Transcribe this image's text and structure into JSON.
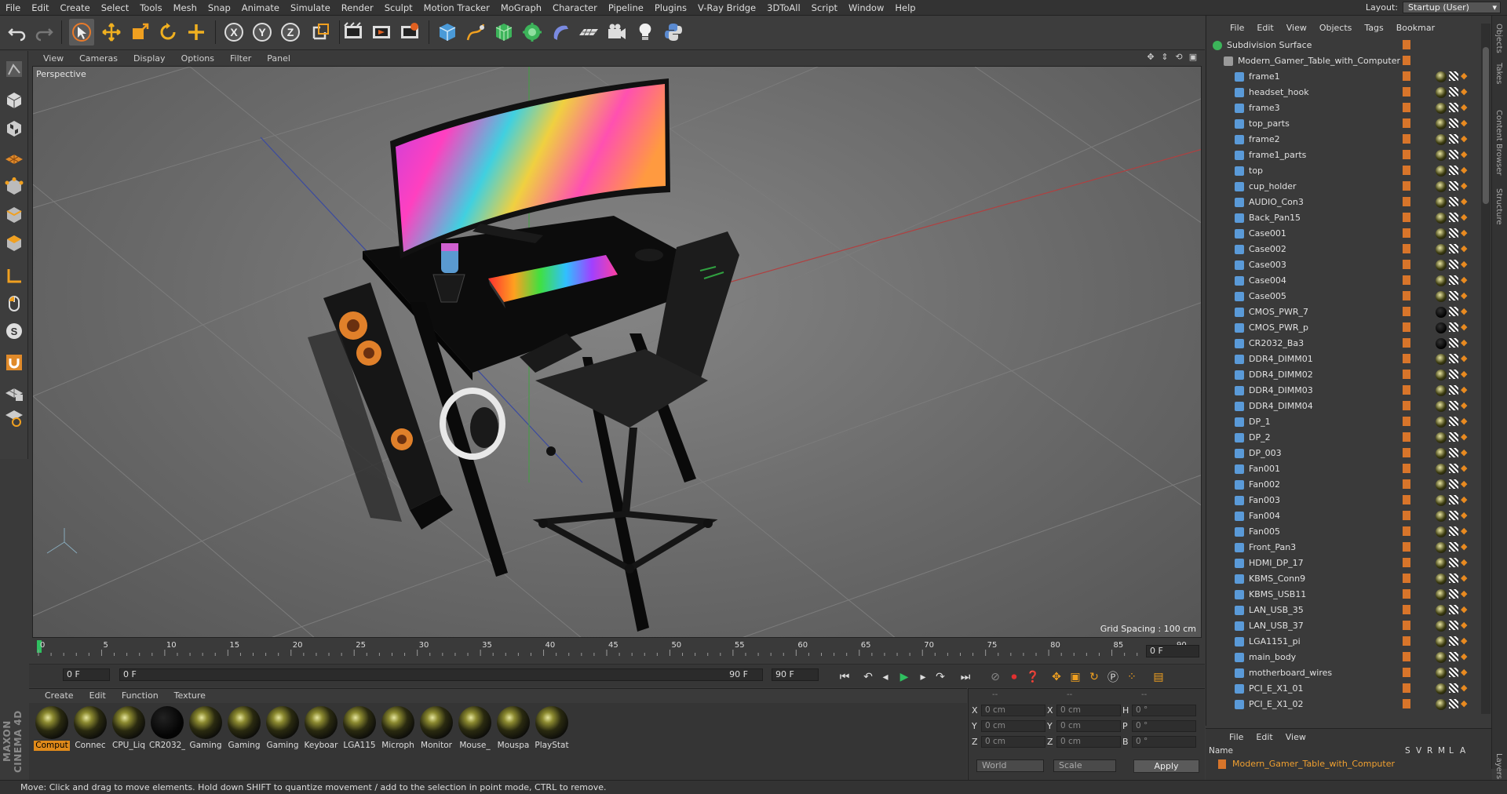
{
  "menubar": {
    "items": [
      "File",
      "Edit",
      "Create",
      "Select",
      "Tools",
      "Mesh",
      "Snap",
      "Animate",
      "Simulate",
      "Render",
      "Sculpt",
      "Motion Tracker",
      "MoGraph",
      "Character",
      "Pipeline",
      "Plugins",
      "V-Ray Bridge",
      "3DToAll",
      "Script",
      "Window",
      "Help"
    ],
    "layout_label": "Layout:",
    "layout_value": "Startup (User)"
  },
  "toolbar": {
    "icons": [
      "undo-icon",
      "redo-icon",
      "select-arrow-icon",
      "move-icon",
      "scale-icon",
      "rotate-icon",
      "add-object-icon",
      "x-axis-icon",
      "y-axis-icon",
      "z-axis-icon",
      "coordinate-system-icon",
      "render-view-icon",
      "render-picture-queue-icon",
      "render-settings-icon",
      "cube-primitive-icon",
      "pen-spline-icon",
      "subdivision-icon",
      "cloner-icon",
      "deformer-icon",
      "floor-icon",
      "camera-icon",
      "light-icon",
      "python-icon"
    ],
    "axis_letters": [
      "X",
      "Y",
      "Z"
    ]
  },
  "viewport": {
    "menu": [
      "View",
      "Cameras",
      "Display",
      "Options",
      "Filter",
      "Panel"
    ],
    "label": "Perspective",
    "grid_spacing": "Grid Spacing : 100 cm"
  },
  "timeline": {
    "ticks": [
      "0",
      "5",
      "10",
      "15",
      "20",
      "25",
      "30",
      "35",
      "40",
      "45",
      "50",
      "55",
      "60",
      "65",
      "70",
      "75",
      "80",
      "85",
      "90"
    ],
    "current_frame": "0 F",
    "start_field": "0 F",
    "range_start": "0 F",
    "range_end": "90 F",
    "end_field": "90 F",
    "end_frame_field": "0 F"
  },
  "materials": {
    "menu": [
      "Create",
      "Edit",
      "Function",
      "Texture"
    ],
    "items": [
      {
        "label": "Comput",
        "dark": false
      },
      {
        "label": "Connec",
        "dark": false
      },
      {
        "label": "CPU_Liq",
        "dark": false
      },
      {
        "label": "CR2032_",
        "dark": true
      },
      {
        "label": "Gaming",
        "dark": false
      },
      {
        "label": "Gaming",
        "dark": false
      },
      {
        "label": "Gaming",
        "dark": false
      },
      {
        "label": "Keyboar",
        "dark": false
      },
      {
        "label": "LGA115",
        "dark": false
      },
      {
        "label": "Microph",
        "dark": false
      },
      {
        "label": "Monitor",
        "dark": false
      },
      {
        "label": "Mouse_",
        "dark": false
      },
      {
        "label": "Mouspa",
        "dark": false
      },
      {
        "label": "PlayStat",
        "dark": false
      }
    ]
  },
  "coords": {
    "head": [
      "--",
      "--",
      "--"
    ],
    "rows": [
      {
        "a": "X",
        "av": "0 cm",
        "b": "X",
        "bv": "0 cm",
        "c": "H",
        "cv": "0 °"
      },
      {
        "a": "Y",
        "av": "0 cm",
        "b": "Y",
        "bv": "0 cm",
        "c": "P",
        "cv": "0 °"
      },
      {
        "a": "Z",
        "av": "0 cm",
        "b": "Z",
        "bv": "0 cm",
        "c": "B",
        "cv": "0 °"
      }
    ],
    "mode": "World",
    "scale": "Scale",
    "apply": "Apply"
  },
  "object_manager": {
    "menu": [
      "File",
      "Edit",
      "View",
      "Objects",
      "Tags",
      "Bookmar"
    ],
    "root": "Subdivision Surface",
    "group": "Modern_Gamer_Table_with_Computer",
    "children": [
      {
        "name": "frame1",
        "mat": "gold"
      },
      {
        "name": "headset_hook",
        "mat": "gold"
      },
      {
        "name": "frame3",
        "mat": "gold"
      },
      {
        "name": "top_parts",
        "mat": "gold"
      },
      {
        "name": "frame2",
        "mat": "gold"
      },
      {
        "name": "frame1_parts",
        "mat": "gold"
      },
      {
        "name": "top",
        "mat": "gold"
      },
      {
        "name": "cup_holder",
        "mat": "gold"
      },
      {
        "name": "AUDIO_Con3",
        "mat": "gold"
      },
      {
        "name": "Back_Pan15",
        "mat": "gold"
      },
      {
        "name": "Case001",
        "mat": "gold"
      },
      {
        "name": "Case002",
        "mat": "gold"
      },
      {
        "name": "Case003",
        "mat": "gold"
      },
      {
        "name": "Case004",
        "mat": "gold"
      },
      {
        "name": "Case005",
        "mat": "gold"
      },
      {
        "name": "CMOS_PWR_7",
        "mat": "black"
      },
      {
        "name": "CMOS_PWR_p",
        "mat": "black"
      },
      {
        "name": "CR2032_Ba3",
        "mat": "black"
      },
      {
        "name": "DDR4_DIMM01",
        "mat": "gold"
      },
      {
        "name": "DDR4_DIMM02",
        "mat": "gold"
      },
      {
        "name": "DDR4_DIMM03",
        "mat": "gold"
      },
      {
        "name": "DDR4_DIMM04",
        "mat": "gold"
      },
      {
        "name": "DP_1",
        "mat": "gold"
      },
      {
        "name": "DP_2",
        "mat": "gold"
      },
      {
        "name": "DP_003",
        "mat": "gold"
      },
      {
        "name": "Fan001",
        "mat": "gold"
      },
      {
        "name": "Fan002",
        "mat": "gold"
      },
      {
        "name": "Fan003",
        "mat": "gold"
      },
      {
        "name": "Fan004",
        "mat": "gold"
      },
      {
        "name": "Fan005",
        "mat": "gold"
      },
      {
        "name": "Front_Pan3",
        "mat": "gold"
      },
      {
        "name": "HDMI_DP_17",
        "mat": "gold"
      },
      {
        "name": "KBMS_Conn9",
        "mat": "gold"
      },
      {
        "name": "KBMS_USB11",
        "mat": "gold"
      },
      {
        "name": "LAN_USB_35",
        "mat": "gold"
      },
      {
        "name": "LAN_USB_37",
        "mat": "gold"
      },
      {
        "name": "LGA1151_pi",
        "mat": "gold"
      },
      {
        "name": "main_body",
        "mat": "gold"
      },
      {
        "name": "motherboard_wires",
        "mat": "gold"
      },
      {
        "name": "PCI_E_X1_01",
        "mat": "gold"
      },
      {
        "name": "PCI_E_X1_02",
        "mat": "gold"
      }
    ]
  },
  "layers": {
    "menu": [
      "File",
      "Edit",
      "View"
    ],
    "header_name": "Name",
    "header_cols": [
      "S",
      "V",
      "R",
      "M",
      "L",
      "A"
    ],
    "row": "Modern_Gamer_Table_with_Computer"
  },
  "side_tabs": [
    "Objects",
    "Takes",
    "Content Browser",
    "Structure",
    "Layers"
  ],
  "status": "Move: Click and drag to move elements. Hold down SHIFT to quantize movement / add to the selection in point mode, CTRL to remove.",
  "maxon": "MAXON CINEMA 4D",
  "colors": {
    "accent": "#e08a1a",
    "background": "#3a3a3a",
    "viewport": "#787878"
  }
}
